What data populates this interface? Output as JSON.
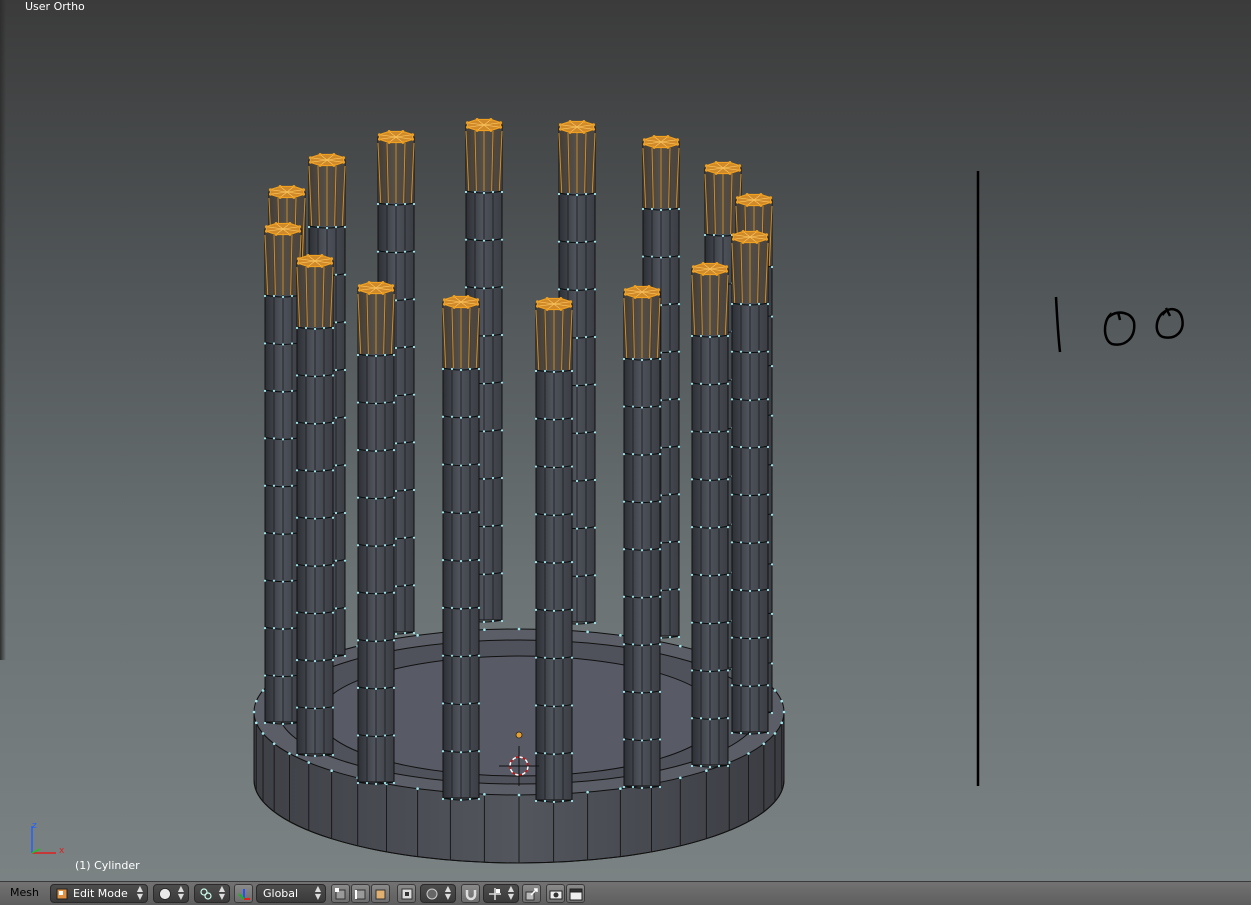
{
  "viewport": {
    "view_name": "User Ortho",
    "object_name": "(1) Cylinder",
    "handwriting_annotation": "100",
    "axis_labels": {
      "x": "x",
      "z": "z"
    },
    "colors": {
      "selected_vertex": "#f0a020",
      "vertex": "#9fe8ee",
      "mesh_face": "#4c5058",
      "annotation": "#000000"
    }
  },
  "toolbar": {
    "menu_mesh": "Mesh",
    "mode": {
      "selected": "Edit Mode",
      "icon": "edit-mode-icon"
    },
    "viewport_shading_icon": "solid-sphere-icon",
    "pivot_icon": "pivot-point-icon",
    "transform_orientation": {
      "selected": "Global",
      "icon": "manipulator-icon"
    },
    "select_mode_icons": [
      "vertex-select-icon",
      "edge-select-icon",
      "face-select-icon"
    ],
    "limit_selection_icon": "limit-selection-icon",
    "proportional_edit_icon": "proportional-edit-icon",
    "snap_icon": "magnet-icon",
    "snap_element_icon": "snap-element-icon",
    "snap_target_icon": "snap-target-icon",
    "render_icons": [
      "camera-icon",
      "clapper-icon"
    ]
  }
}
